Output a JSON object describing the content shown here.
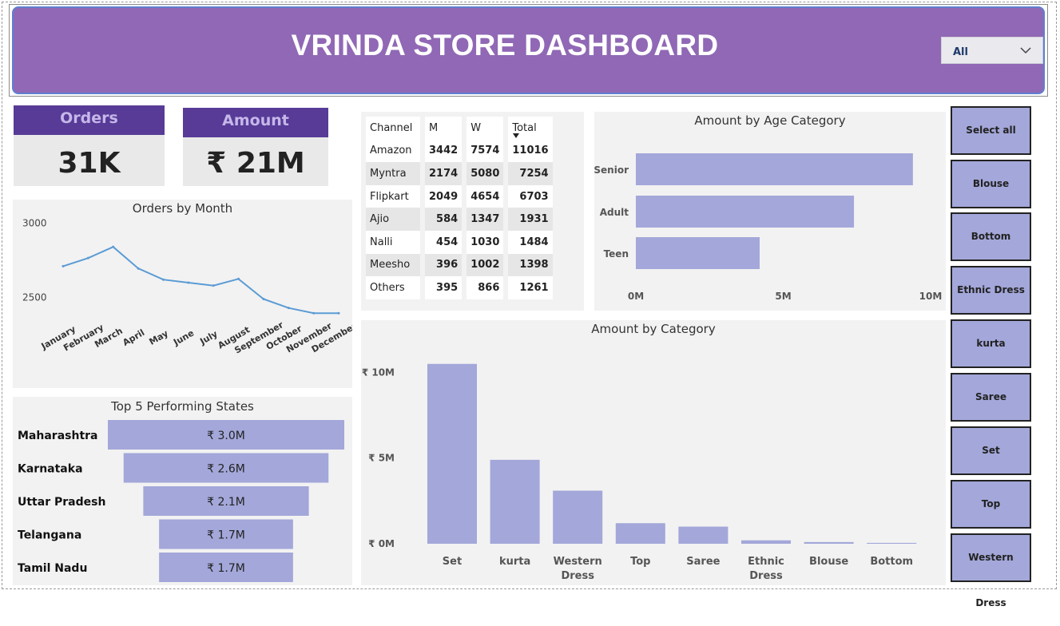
{
  "header": {
    "title": "VRINDA STORE DASHBOARD",
    "filter_value": "All"
  },
  "kpis": [
    {
      "label": "Orders",
      "value": "31K"
    },
    {
      "label": "Amount",
      "value": "₹ 21M"
    }
  ],
  "channel_table": {
    "headers": [
      "Channel",
      "M",
      "W",
      "Total"
    ],
    "rows": [
      [
        "Amazon",
        "3442",
        "7574",
        "11016"
      ],
      [
        "Myntra",
        "2174",
        "5080",
        "7254"
      ],
      [
        "Flipkart",
        "2049",
        "4654",
        "6703"
      ],
      [
        "Ajio",
        "584",
        "1347",
        "1931"
      ],
      [
        "Nalli",
        "454",
        "1030",
        "1484"
      ],
      [
        "Meesho",
        "396",
        "1002",
        "1398"
      ],
      [
        "Others",
        "395",
        "866",
        "1261"
      ]
    ]
  },
  "slicer": {
    "items": [
      "Select all",
      "Blouse",
      "Bottom",
      "Ethnic Dress",
      "kurta",
      "Saree",
      "Set",
      "Top",
      "Western Dress"
    ]
  },
  "chart_data": [
    {
      "type": "line",
      "title": "Orders by Month",
      "x": [
        "January",
        "February",
        "March",
        "April",
        "May",
        "June",
        "July",
        "August",
        "September",
        "October",
        "November",
        "December"
      ],
      "series": [
        {
          "values": [
            2710,
            2765,
            2840,
            2695,
            2620,
            2600,
            2580,
            2625,
            2490,
            2430,
            2395,
            2395
          ]
        }
      ],
      "ytick_labels": [
        "3000",
        "2500"
      ],
      "yticks": [
        3000,
        2500
      ],
      "ylim": [
        2380,
        3050
      ],
      "color": "#5b9bd5"
    },
    {
      "type": "bar",
      "orientation": "horizontal",
      "title": "Top 5 Performing States",
      "categories": [
        "Maharashtra",
        "Karnataka",
        "Uttar Pradesh",
        "Telangana",
        "Tamil Nadu"
      ],
      "values": [
        3.0,
        2.6,
        2.1,
        1.7,
        1.7
      ],
      "value_labels": [
        "₹ 3.0M",
        "₹ 2.6M",
        "₹ 2.1M",
        "₹ 1.7M",
        "₹ 1.7M"
      ],
      "color": "#a3a7d9"
    },
    {
      "type": "bar",
      "orientation": "horizontal",
      "title": "Amount by Age Category",
      "categories": [
        "Senior",
        "Adult",
        "Teen"
      ],
      "values": [
        9.4,
        7.4,
        4.2
      ],
      "xtick_labels": [
        "0M",
        "5M",
        "10M"
      ],
      "xticks": [
        0,
        5,
        10
      ],
      "xlim": [
        0,
        10
      ],
      "color": "#a3a7d9"
    },
    {
      "type": "bar",
      "title": "Amount by Category",
      "categories": [
        "Set",
        "kurta",
        "Western Dress",
        "Top",
        "Saree",
        "Ethnic Dress",
        "Blouse",
        "Bottom"
      ],
      "values": [
        10.5,
        4.9,
        3.1,
        1.2,
        1.0,
        0.2,
        0.1,
        0.05
      ],
      "ytick_labels": [
        "₹ 10M",
        "₹ 5M",
        "₹ 0M"
      ],
      "yticks": [
        10,
        5,
        0
      ],
      "ylim": [
        0,
        11
      ],
      "color": "#a3a7d9"
    }
  ]
}
